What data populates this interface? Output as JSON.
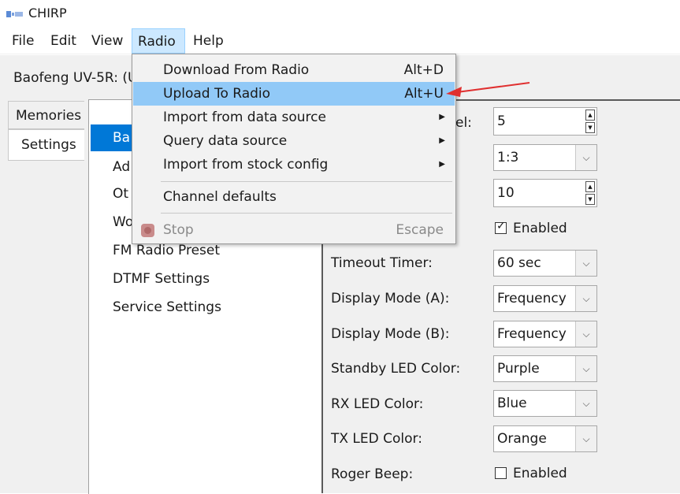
{
  "window": {
    "title": "CHIRP"
  },
  "menubar": {
    "file": "File",
    "edit": "Edit",
    "view": "View",
    "radio": "Radio",
    "help": "Help"
  },
  "radio_label": "Baofeng UV-5R: (U",
  "tabs": {
    "memories": "Memories",
    "settings": "Settings"
  },
  "tree": {
    "items": [
      "Ba",
      "Ad",
      "Ot",
      "Wo",
      "FM Radio Preset",
      "DTMF Settings",
      "Service Settings"
    ]
  },
  "radio_menu": {
    "download": {
      "label": "Download From Radio",
      "accel": "Alt+D"
    },
    "upload": {
      "label": "Upload To Radio",
      "accel": "Alt+U"
    },
    "import_source": {
      "label": "Import from data source",
      "submenu": "▶"
    },
    "query_source": {
      "label": "Query data source",
      "submenu": "▶"
    },
    "import_stock": {
      "label": "Import from stock config",
      "submenu": "▶"
    },
    "channel_defaults": {
      "label": "Channel defaults"
    },
    "stop": {
      "label": "Stop",
      "accel": "Escape"
    }
  },
  "form": {
    "partial_label": "el:",
    "squelch_value": "5",
    "row2_value": "1:3",
    "row3_value": "10",
    "row4_checkbox": "Enabled",
    "timeout": {
      "label": "Timeout Timer:",
      "value": "60 sec"
    },
    "display_a": {
      "label": "Display Mode (A):",
      "value": "Frequency"
    },
    "display_b": {
      "label": "Display Mode (B):",
      "value": "Frequency"
    },
    "standby_led": {
      "label": "Standby LED Color:",
      "value": "Purple"
    },
    "rx_led": {
      "label": "RX LED Color:",
      "value": "Blue"
    },
    "tx_led": {
      "label": "TX LED Color:",
      "value": "Orange"
    },
    "roger_beep": {
      "label": "Roger Beep:",
      "checkbox": "Enabled"
    }
  },
  "icons": {
    "combo_arrow": "⌵",
    "check_mark": "✓",
    "spin_up": "▲",
    "spin_down": "▼"
  },
  "colors": {
    "menu_highlight": "#91c9f7",
    "tree_selected": "#0078d7",
    "arrow": "#e03030"
  }
}
